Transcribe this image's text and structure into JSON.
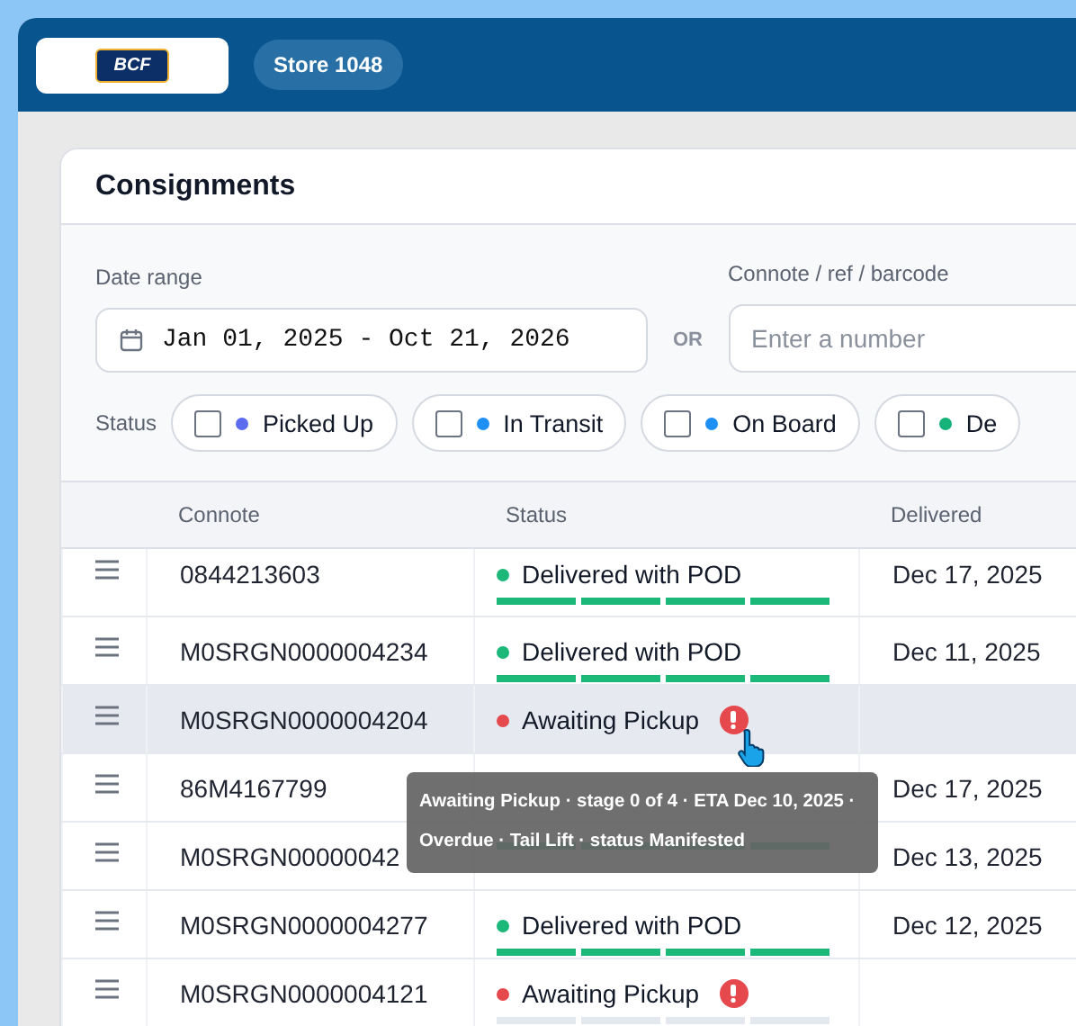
{
  "header": {
    "logo": "BCF",
    "store": "Store 1048"
  },
  "card": {
    "title": "Consignments"
  },
  "filters": {
    "date_label": "Date range",
    "date_value": "Jan 01, 2025 - Oct 21, 2026",
    "or": "OR",
    "search_label": "Connote / ref / barcode",
    "search_placeholder": "Enter a number",
    "status_label": "Status",
    "statuses": [
      {
        "label": "Picked Up",
        "checked": false,
        "color": "#5b6cf0"
      },
      {
        "label": "In Transit",
        "checked": false,
        "color": "#1e90f5"
      },
      {
        "label": "On Board",
        "checked": false,
        "color": "#1e90f5"
      },
      {
        "label": "De",
        "checked": false,
        "color": "#16b27a"
      }
    ]
  },
  "table": {
    "columns": [
      "Connote",
      "Status",
      "Delivered"
    ],
    "rows": [
      {
        "connote": "0844213603",
        "status": "Delivered with POD",
        "color": "#1cb87a",
        "level": 1,
        "delivered": "Dec 17, 2025",
        "hovered": false
      },
      {
        "connote": "M0SRGN0000004234",
        "status": "Delivered with POD",
        "color": "#1cb87a",
        "level": 1,
        "delivered": "Dec 11, 2025",
        "hovered": false
      },
      {
        "connote": "M0SRGN0000004204",
        "status": "Awaiting Pickup",
        "color": "#e5484d",
        "alert": true,
        "hovered": true
      },
      {
        "connote": "86M4167799",
        "delivered": "Dec 17, 2025",
        "hovered": false
      },
      {
        "connote": "M0SRGN00000042",
        "level": 1,
        "delivered": "Dec 13, 2025",
        "hovered": false
      },
      {
        "connote": "M0SRGN0000004277",
        "status": "Delivered with POD",
        "color": "#1cb87a",
        "level": 1,
        "delivered": "Dec 12, 2025",
        "hovered": false
      },
      {
        "connote": "M0SRGN0000004121",
        "status": "Awaiting Pickup",
        "color": "#e5484d",
        "level": 0,
        "alert": true,
        "hovered": false
      }
    ]
  },
  "tooltip": {
    "text": "Awaiting Pickup · stage 0 of 4 · ETA Dec 10, 2025 · Overdue · Tail Lift · status Manifested"
  }
}
